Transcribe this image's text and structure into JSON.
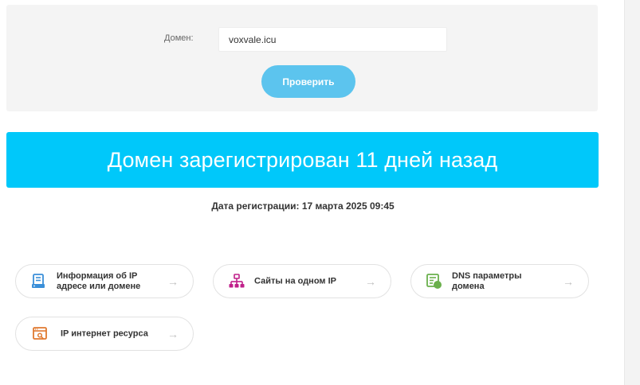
{
  "form": {
    "domain_label": "Домен:",
    "domain_value": "voxvale.icu",
    "check_button_label": "Проверить"
  },
  "banner": {
    "text": "Домен зарегистрирован 11 дней назад"
  },
  "registration": {
    "text": "Дата регистрации: 17 марта 2025 09:45"
  },
  "cards": [
    {
      "label": "Информация об IP адресе или домене",
      "icon": "server-info-icon",
      "arrow": "→"
    },
    {
      "label": "Сайты на одном IP",
      "icon": "sitemap-icon",
      "arrow": "→"
    },
    {
      "label": "DNS параметры домена",
      "icon": "dns-settings-icon",
      "arrow": "→"
    },
    {
      "label": "IP интернет ресурса",
      "icon": "browser-ip-icon",
      "arrow": "→"
    }
  ],
  "colors": {
    "banner": "#00c8fa",
    "button": "#5cc4ee",
    "icon_blue": "#3a8fd9",
    "icon_magenta": "#c0208a",
    "icon_green": "#6ab04c",
    "icon_orange": "#e07a30"
  }
}
